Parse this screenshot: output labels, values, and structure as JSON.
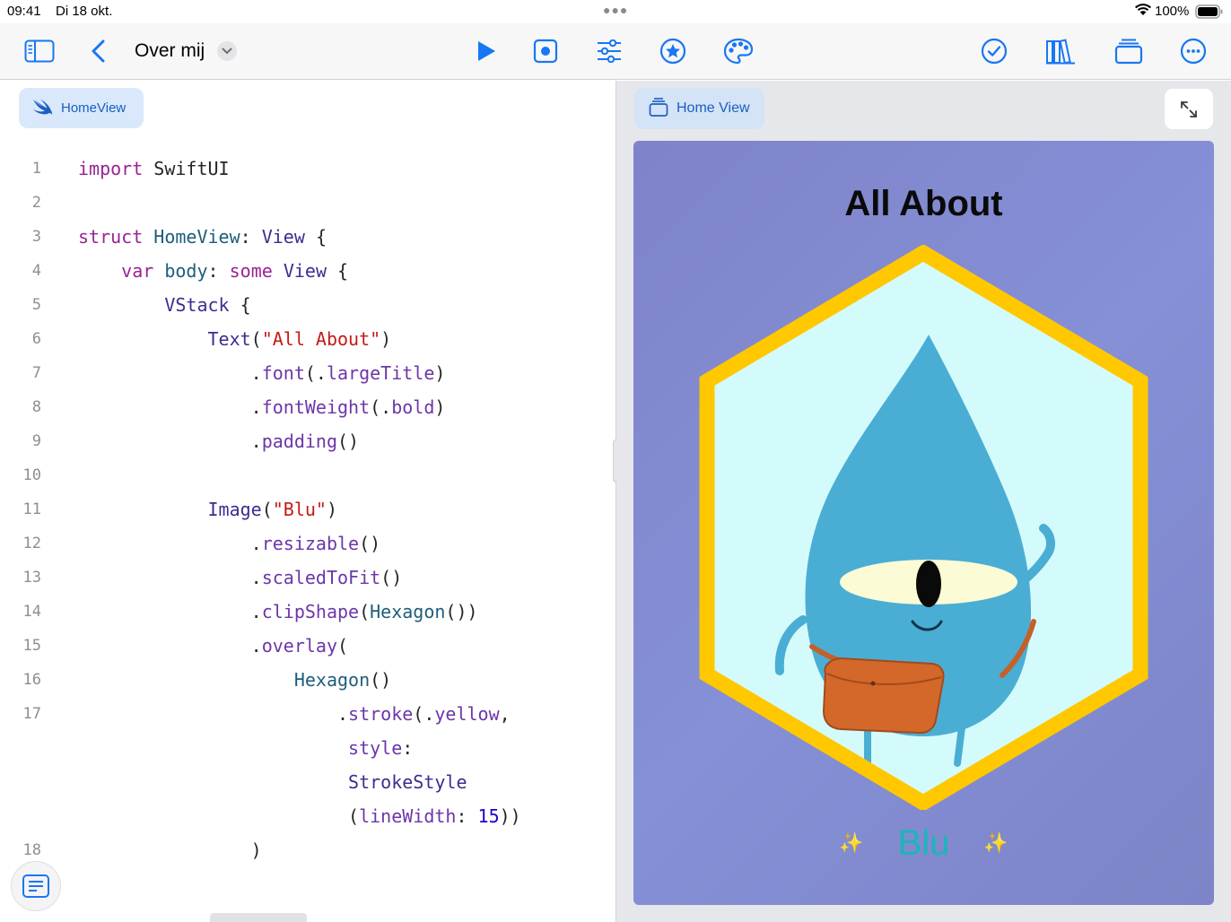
{
  "status_bar": {
    "time": "09:41",
    "date": "Di 18 okt.",
    "battery": "100%"
  },
  "toolbar": {
    "title": "Over mij",
    "left_icons": [
      "sidebar-icon",
      "back-chevron-icon"
    ],
    "center_icons": [
      "play-icon",
      "record-icon",
      "sliders-icon",
      "star-icon",
      "palette-icon"
    ],
    "right_icons": [
      "checkmark-icon",
      "library-icon",
      "window-stack-icon",
      "more-icon"
    ]
  },
  "editor": {
    "file_tab": "HomeView",
    "lines": [
      {
        "n": "1"
      },
      {
        "n": "2"
      },
      {
        "n": "3"
      },
      {
        "n": "4"
      },
      {
        "n": "5"
      },
      {
        "n": "6"
      },
      {
        "n": "7"
      },
      {
        "n": "8"
      },
      {
        "n": "9"
      },
      {
        "n": "10"
      },
      {
        "n": "11"
      },
      {
        "n": "12"
      },
      {
        "n": "13"
      },
      {
        "n": "14"
      },
      {
        "n": "15"
      },
      {
        "n": "16"
      },
      {
        "n": "17"
      },
      {
        "n": ""
      },
      {
        "n": ""
      },
      {
        "n": ""
      },
      {
        "n": "18"
      }
    ],
    "tokens": {
      "import": "import",
      "swiftui": "SwiftUI",
      "struct": "struct",
      "homeview": "HomeView",
      "colon": ":",
      "view": "View",
      "brace_open": "{",
      "var": "var",
      "body": "body",
      "some": "some",
      "vstack": "VStack",
      "text": "Text",
      "all_about": "\"All About\"",
      "font": "font",
      "large_title": "largeTitle",
      "font_weight": "fontWeight",
      "bold": "bold",
      "padding": "padding",
      "image": "Image",
      "blu": "\"Blu\"",
      "resizable": "resizable",
      "scaled_to_fit": "scaledToFit",
      "clip_shape": "clipShape",
      "hexagon": "Hexagon",
      "overlay": "overlay",
      "stroke": "stroke",
      "yellow": "yellow",
      "style": "style",
      "stroke_style": "StrokeStyle",
      "line_width": "lineWidth",
      "fifteen": "15"
    }
  },
  "preview": {
    "view_tab": "Home View",
    "card_title": "All About",
    "name": "Blu",
    "colors": {
      "card_background": "#8189d0",
      "hexagon_stroke": "#ffc800",
      "hexagon_fill": "#d4fbfb",
      "character": "#4aaed4",
      "bag": "#d4672a",
      "name_text": "#1bb6b9"
    }
  }
}
